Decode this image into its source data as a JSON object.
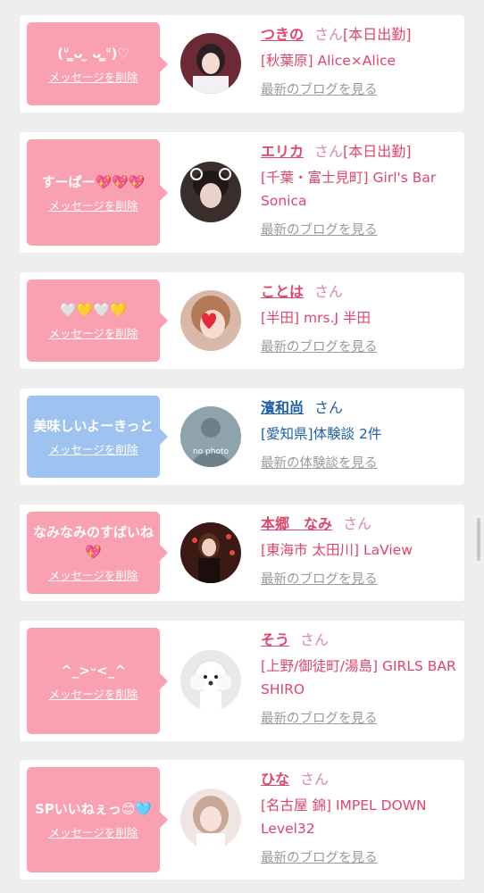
{
  "cards": [
    {
      "message": "(ᐡ ̳ᴗ  ̫ ᴗ ̳ᐡ)♡",
      "delete_label": "メッセージを削除",
      "name": "つきの",
      "san": "さん",
      "status": "[本日出勤]",
      "shop": "[秋葉原] Alice×Alice",
      "blog_link": "最新のブログを見る",
      "avatar": "photo"
    },
    {
      "message": "すーぱー💖💖💖",
      "delete_label": "メッセージを削除",
      "name": "エリカ",
      "san": "さん",
      "status": "[本日出勤]",
      "shop": "[千葉・富士見町] Girl's Bar Sonica",
      "blog_link": "最新のブログを見る",
      "avatar": "photo"
    },
    {
      "message": "🤍💛🤍💛",
      "delete_label": "メッセージを削除",
      "name": "ことは",
      "san": "さん",
      "status": "",
      "shop": "[半田] mrs.J 半田",
      "blog_link": "最新のブログを見る",
      "avatar": "photo"
    },
    {
      "message": "美味しいよーきっと",
      "delete_label": "メッセージを削除",
      "name": "濱和尚",
      "san": "さん",
      "status": "",
      "shop": "[愛知県]体験談 2件",
      "blog_link": "最新の体験談を見る",
      "avatar": "no-photo",
      "avatar_text": "no photo"
    },
    {
      "message": "なみなみのすばいね💖",
      "delete_label": "メッセージを削除",
      "name": "本郷　なみ",
      "san": "さん",
      "status": "",
      "shop": "[東海市 太田川] LaView",
      "blog_link": "最新のブログを見る",
      "avatar": "photo"
    },
    {
      "message": "^_>ᵕ<_^",
      "delete_label": "メッセージを削除",
      "name": "そう",
      "san": "さん",
      "status": "",
      "shop": "[上野/御徒町/湯島] GIRLS BAR SHIRO",
      "blog_link": "最新のブログを見る",
      "avatar": "dog"
    },
    {
      "message": "SPいいねぇっ😊🩵",
      "delete_label": "メッセージを削除",
      "name": "ひな",
      "san": "さん",
      "status": "",
      "shop": "[名古屋 錦] IMPEL DOWN Level32",
      "blog_link": "最新のブログを見る",
      "avatar": "photo"
    }
  ],
  "colors": {
    "pink": "#f9a0b1",
    "blue": "#9fc3f0",
    "name_pink": "#e0456a",
    "name_blue": "#1e5fa8"
  }
}
